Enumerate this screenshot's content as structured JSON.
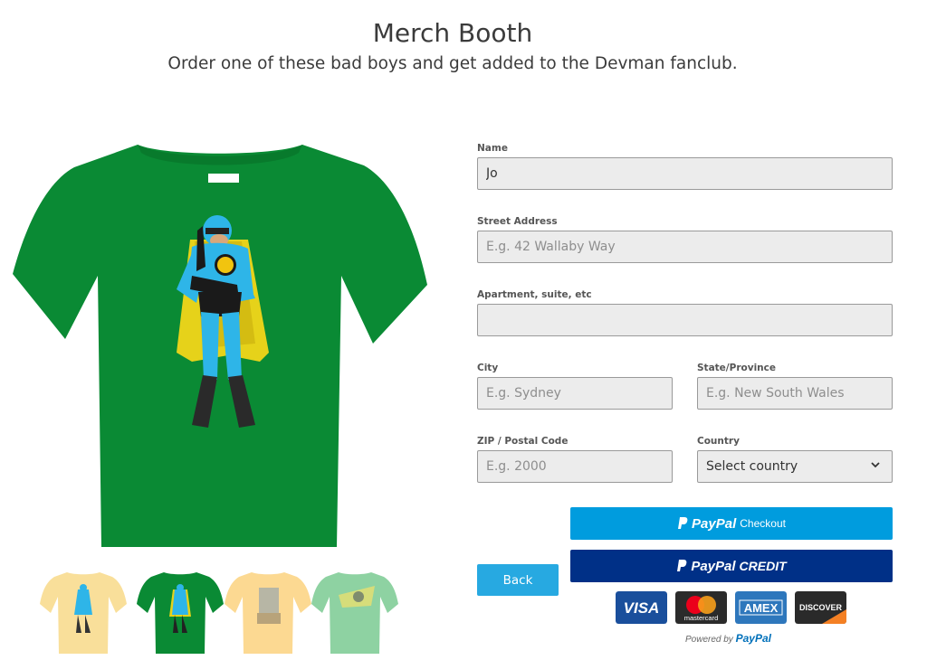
{
  "header": {
    "title": "Merch Booth",
    "subtitle": "Order one of these bad boys and get added to the Devman fanclub."
  },
  "form": {
    "name": {
      "label": "Name",
      "value": "Jo",
      "placeholder": ""
    },
    "street": {
      "label": "Street Address",
      "value": "",
      "placeholder": "E.g. 42 Wallaby Way"
    },
    "apartment": {
      "label": "Apartment, suite, etc",
      "value": "",
      "placeholder": ""
    },
    "city": {
      "label": "City",
      "value": "",
      "placeholder": "E.g. Sydney"
    },
    "state": {
      "label": "State/Province",
      "value": "",
      "placeholder": "E.g. New South Wales"
    },
    "zip": {
      "label": "ZIP / Postal Code",
      "value": "",
      "placeholder": "E.g. 2000"
    },
    "country": {
      "label": "Country",
      "selected": "Select country"
    }
  },
  "buttons": {
    "back": "Back",
    "paypal_checkout_brand": "PayPal",
    "paypal_checkout_label": "Checkout",
    "paypal_credit_brand": "PayPal",
    "paypal_credit_label": "CREDIT"
  },
  "cards": {
    "visa": "VISA",
    "mastercard": "mastercard",
    "amex": "AMEX",
    "discover": "DISCOVER"
  },
  "powered_by": {
    "prefix": "Powered by",
    "brand": "PayPal"
  },
  "shirts": {
    "main_color": "#0a8a34",
    "thumb_colors": [
      "#f9df9a",
      "#0a8a34",
      "#fcd992",
      "#8ed2a2"
    ]
  },
  "colors": {
    "back_button": "#27a9e1",
    "paypal_checkout": "#009cde",
    "paypal_credit": "#003087"
  }
}
